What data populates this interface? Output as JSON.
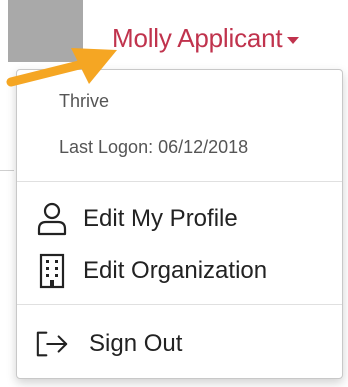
{
  "header": {
    "user_name": "Molly Applicant"
  },
  "dropdown": {
    "organization": "Thrive",
    "last_logon": "Last Logon: 06/12/2018",
    "items": [
      {
        "label": "Edit My Profile",
        "icon": "person-icon"
      },
      {
        "label": "Edit Organization",
        "icon": "building-icon"
      },
      {
        "label": "Sign Out",
        "icon": "sign-out-icon"
      }
    ]
  },
  "colors": {
    "accent": "#c0334d",
    "annotation_arrow": "#f5a623"
  }
}
